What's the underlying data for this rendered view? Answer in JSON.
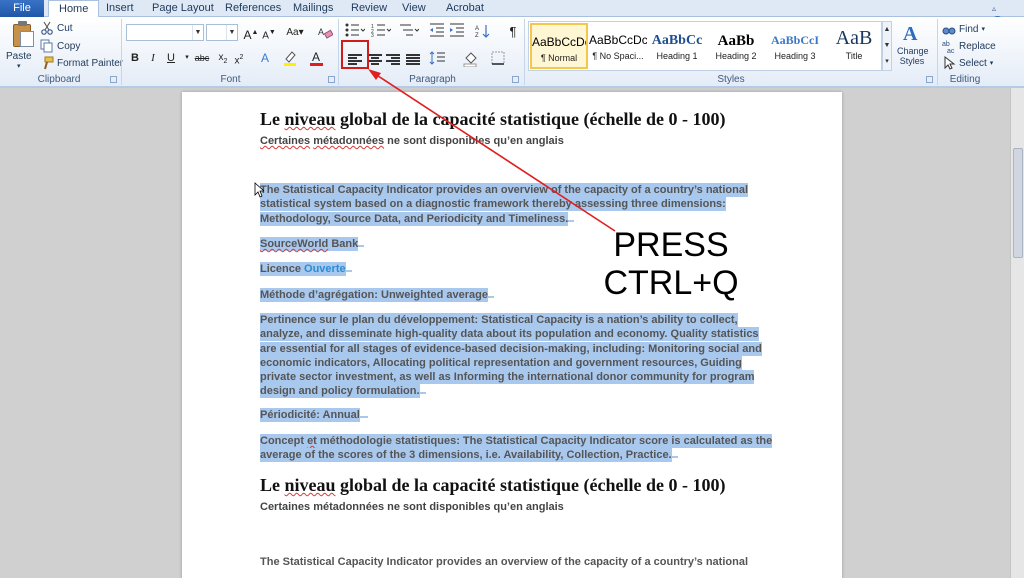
{
  "tabs": [
    {
      "label": "File"
    },
    {
      "label": "Home"
    },
    {
      "label": "Insert"
    },
    {
      "label": "Page Layout"
    },
    {
      "label": "References"
    },
    {
      "label": "Mailings"
    },
    {
      "label": "Review"
    },
    {
      "label": "View"
    },
    {
      "label": "Acrobat"
    }
  ],
  "clipboard": {
    "paste": "Paste",
    "cut": "Cut",
    "copy": "Copy",
    "format_painter": "Format Painter",
    "label": "Clipboard"
  },
  "font": {
    "label": "Font",
    "name_value": "",
    "size_value": ""
  },
  "paragraph": {
    "label": "Paragraph"
  },
  "styles": {
    "label": "Styles",
    "items": [
      {
        "preview": "AaBbCcDc",
        "name": "¶ Normal"
      },
      {
        "preview": "AaBbCcDc",
        "name": "¶ No Spaci..."
      },
      {
        "preview": "AaBbCc",
        "name": "Heading 1"
      },
      {
        "preview": "AaBb",
        "name": "Heading 2"
      },
      {
        "preview": "AaBbCcI",
        "name": "Heading 3"
      },
      {
        "preview": "AaB",
        "name": "Title"
      }
    ],
    "change_styles": "Change Styles"
  },
  "editing": {
    "label": "Editing",
    "find": "Find",
    "replace": "Replace",
    "select": "Select"
  },
  "colors": {
    "accent": "#1f57a8",
    "selection": "#a9c8ee",
    "annotation_red": "#d21c1c",
    "link_blue": "#2a8dd4"
  },
  "document": {
    "heading1_pre": "Le ",
    "heading1_sq": "niveau",
    "heading1_post": " global de la capacité statistique (échelle de 0 - 100)",
    "sub1_a": "Certaines",
    "sub1_b": "métadonnées",
    "sub1_c": " ne sont disponibles qu’en anglais",
    "p1_lines": [
      "The Statistical Capacity Indicator provides an overview of the capacity of a country’s national",
      "statistical system based on a diagnostic framework thereby assessing three dimensions:",
      "Methodology, Source Data, and Periodicity and Timeliness."
    ],
    "source_sq": "SourceWorld",
    "source_post": " Bank",
    "licence_pre": "Licence ",
    "licence_link": "Ouverte",
    "methode": "Méthode d’agrégation: Unweighted average",
    "p2_lines": [
      "Pertinence sur le plan du développement: Statistical Capacity is a nation’s ability to collect,",
      "analyze, and disseminate high-quality data about its population and economy. Quality statistics",
      "are essential for all stages of evidence-based decision-making, including: Monitoring social and",
      "economic indicators, Allocating political representation and government resources, Guiding",
      "private sector investment, as well as Informing the international donor community for program",
      "design and policy formulation."
    ],
    "periodicite": "Périodicité: Annual",
    "p3_line1_pre": "Concept ",
    "p3_line1_sq": "et",
    "p3_line1_post": " méthodologie statistiques: The Statistical Capacity Indicator score is calculated as the",
    "p3_line2": "average of the scores of the 3 dimensions, i.e. Availability, Collection, Practice.",
    "heading2_pre": "Le ",
    "heading2_sq": "niveau",
    "heading2_post": " global de la capacité statistique (échelle de 0 - 100)",
    "sub2": "Certaines métadonnées ne sont disponibles qu’en anglais",
    "p4_line1": "The Statistical Capacity Indicator provides an overview of the capacity of a country’s national"
  },
  "annotation": {
    "line1": "PRESS",
    "line2": "CTRL+Q"
  }
}
